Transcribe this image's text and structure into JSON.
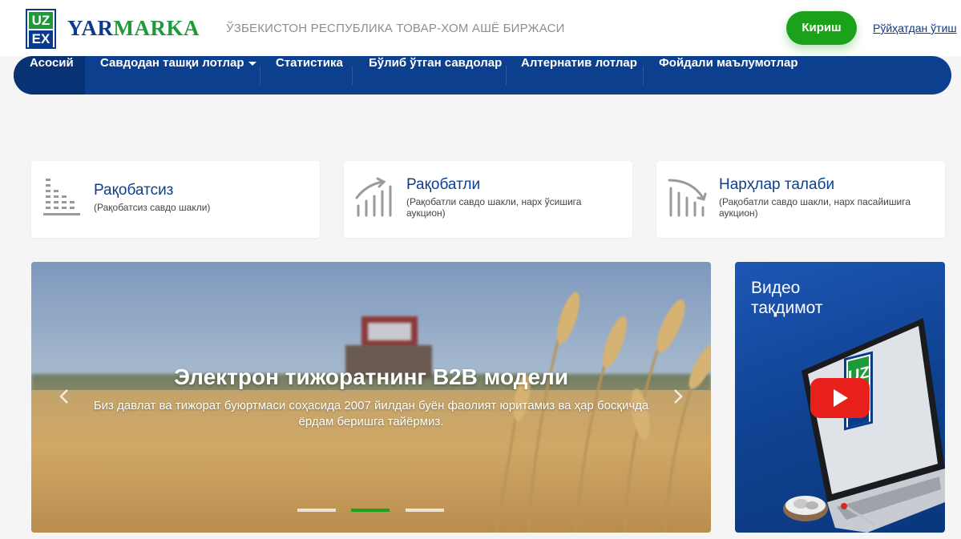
{
  "header": {
    "logo_top": "UZ",
    "logo_bottom": "EX",
    "brand_first": "YAR",
    "brand_second": "MARKA",
    "tagline": "ЎЗБЕКИСТОН РЕСПУБЛИКА ТОВАР-ХОМ АШЁ БИРЖАСИ",
    "login_label": "Кириш",
    "register_label": "Рўйҳатдан ўтиш"
  },
  "nav": {
    "items": [
      {
        "label": "Асосий",
        "active": true
      },
      {
        "label": "Савдодан ташқи лотлар",
        "has_dropdown": true
      },
      {
        "label": "Статистика"
      },
      {
        "label": "Бўлиб ўтган савдолар"
      },
      {
        "label": "Алтернатив лотлар"
      },
      {
        "label": "Фойдали маълумотлар"
      }
    ]
  },
  "cards": [
    {
      "title": "Рақобатсиз",
      "subtitle": "(Рақобатсиз савдо шакли)",
      "icon": "bar-chart-icon"
    },
    {
      "title": "Рақобатли",
      "subtitle": "(Рақобатли савдо шакли, нарх ўсишига аукцион)",
      "icon": "trend-up-icon"
    },
    {
      "title": "Нарҳлар талаби",
      "subtitle": "(Рақобатли савдо шакли, нарх пасайишига аукцион)",
      "icon": "trend-down-icon"
    }
  ],
  "slider": {
    "title": "Электрон тижоратнинг B2B модели",
    "text": "Биз давлат ва тижорат буюртмаси соҳасида 2007 йилдан буён фаолият юритамиз ва ҳар босқичда ёрдам беришга тайёрмиз.",
    "slide_count": 3,
    "active_slide": 2
  },
  "video": {
    "title": "Видео тақдимот",
    "screen_logo_top": "UZ",
    "screen_logo_bottom": "EX"
  },
  "colors": {
    "primary": "#0c3f8e",
    "accent_green": "#1aa31a",
    "logo_green": "#1f9a3a"
  }
}
